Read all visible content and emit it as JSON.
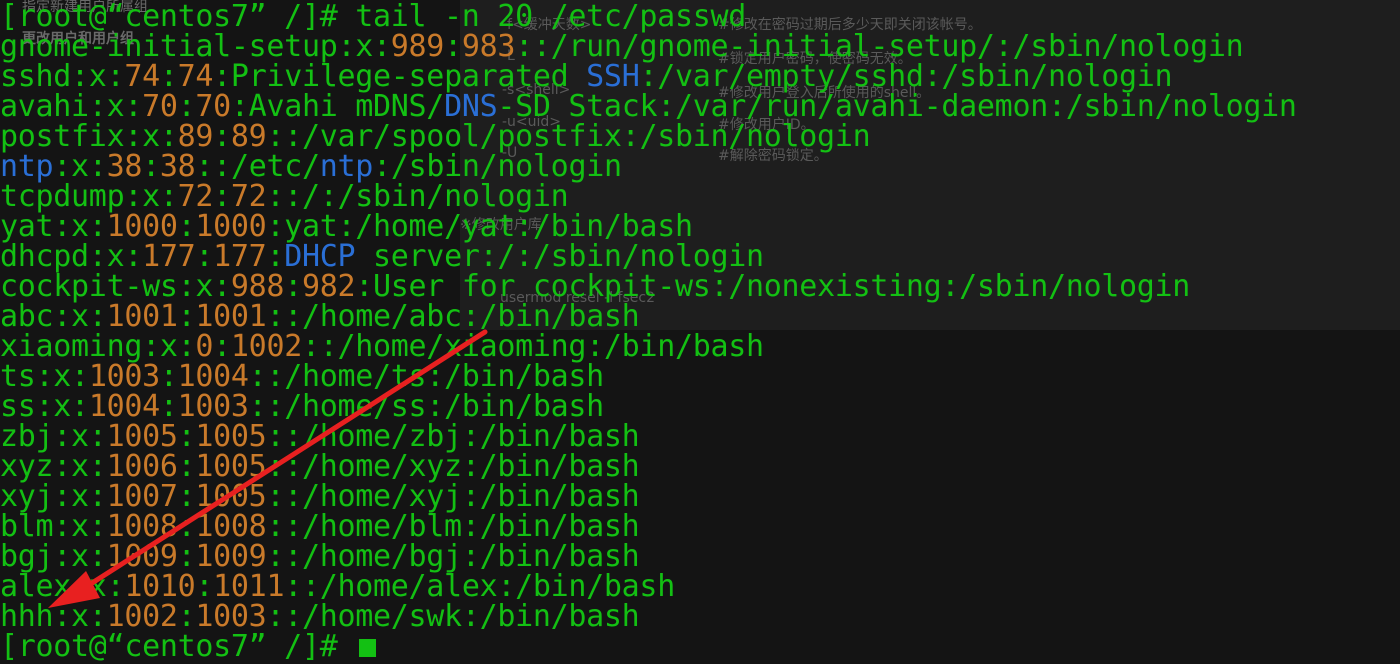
{
  "background_text": {
    "top_left": "指定新建用户所属组",
    "heading": "更改用户和用户组",
    "items": [
      {
        "text": "-f<缓冲天数>"
      },
      {
        "text": "#修改在密码过期后多少天即关闭该帐号。"
      },
      {
        "text": "-L"
      },
      {
        "text": "#锁定用户密码，使密码无效。"
      },
      {
        "text": "-s<shell>"
      },
      {
        "text": "#修改用户登入后所使用的shell。"
      },
      {
        "text": "-u<uid>"
      },
      {
        "text": "#修改用户ID。"
      },
      {
        "text": "-U"
      },
      {
        "text": "#解除密码锁定。"
      },
      {
        "text": "※修改用户库"
      },
      {
        "text": "usermod resel -l fsec2"
      }
    ]
  },
  "terminal": {
    "command_line": "[root@“centos7” /]# tail -n 20 /etc/passwd",
    "prompt_line": "[root@“centos7” /]# ",
    "lines": [
      [
        {
          "t": "gnome-initial-setup:x:",
          "c": "g"
        },
        {
          "t": "989",
          "c": "n"
        },
        {
          "t": ":",
          "c": "g"
        },
        {
          "t": "983",
          "c": "n"
        },
        {
          "t": "::/run/gnome-initial-setup/:/sbin/nologin",
          "c": "g"
        }
      ],
      [
        {
          "t": "sshd:x:",
          "c": "g"
        },
        {
          "t": "74",
          "c": "n"
        },
        {
          "t": ":",
          "c": "g"
        },
        {
          "t": "74",
          "c": "n"
        },
        {
          "t": ":Privilege-separated ",
          "c": "g"
        },
        {
          "t": "SSH",
          "c": "b"
        },
        {
          "t": ":/var/empty/sshd:/sbin/nologin",
          "c": "g"
        }
      ],
      [
        {
          "t": "avahi:x:",
          "c": "g"
        },
        {
          "t": "70",
          "c": "n"
        },
        {
          "t": ":",
          "c": "g"
        },
        {
          "t": "70",
          "c": "n"
        },
        {
          "t": ":Avahi mDNS/",
          "c": "g"
        },
        {
          "t": "DNS",
          "c": "b"
        },
        {
          "t": "-SD Stack:/var/run/avahi-daemon:/sbin/nologin",
          "c": "g"
        }
      ],
      [
        {
          "t": "postfix:x:",
          "c": "g"
        },
        {
          "t": "89",
          "c": "n"
        },
        {
          "t": ":",
          "c": "g"
        },
        {
          "t": "89",
          "c": "n"
        },
        {
          "t": "::/var/spool/postfix:/sbin/nologin",
          "c": "g"
        }
      ],
      [
        {
          "t": "ntp",
          "c": "b"
        },
        {
          "t": ":x:",
          "c": "g"
        },
        {
          "t": "38",
          "c": "n"
        },
        {
          "t": ":",
          "c": "g"
        },
        {
          "t": "38",
          "c": "n"
        },
        {
          "t": "::/etc/",
          "c": "g"
        },
        {
          "t": "ntp",
          "c": "b"
        },
        {
          "t": ":/sbin/nologin",
          "c": "g"
        }
      ],
      [
        {
          "t": "tcpdump:x:",
          "c": "g"
        },
        {
          "t": "72",
          "c": "n"
        },
        {
          "t": ":",
          "c": "g"
        },
        {
          "t": "72",
          "c": "n"
        },
        {
          "t": "::/:/sbin/nologin",
          "c": "g"
        }
      ],
      [
        {
          "t": "yat:x:",
          "c": "g"
        },
        {
          "t": "1000",
          "c": "n"
        },
        {
          "t": ":",
          "c": "g"
        },
        {
          "t": "1000",
          "c": "n"
        },
        {
          "t": ":yat:/home/yat:/bin/bash",
          "c": "g"
        }
      ],
      [
        {
          "t": "dhcpd:x:",
          "c": "g"
        },
        {
          "t": "177",
          "c": "n"
        },
        {
          "t": ":",
          "c": "g"
        },
        {
          "t": "177",
          "c": "n"
        },
        {
          "t": ":",
          "c": "g"
        },
        {
          "t": "DHCP",
          "c": "b"
        },
        {
          "t": " server:/:/sbin/nologin",
          "c": "g"
        }
      ],
      [
        {
          "t": "cockpit-ws:x:",
          "c": "g"
        },
        {
          "t": "988",
          "c": "n"
        },
        {
          "t": ":",
          "c": "g"
        },
        {
          "t": "982",
          "c": "n"
        },
        {
          "t": ":User for cockpit-ws:/nonexisting:/sbin/nologin",
          "c": "g"
        }
      ],
      [
        {
          "t": "abc:x:",
          "c": "g"
        },
        {
          "t": "1001",
          "c": "n"
        },
        {
          "t": ":",
          "c": "g"
        },
        {
          "t": "1001",
          "c": "n"
        },
        {
          "t": "::/home/abc:/bin/bash",
          "c": "g"
        }
      ],
      [
        {
          "t": "xiaoming:x:",
          "c": "g"
        },
        {
          "t": "0",
          "c": "n"
        },
        {
          "t": ":",
          "c": "g"
        },
        {
          "t": "1002",
          "c": "n"
        },
        {
          "t": "::/home/xiaoming:/bin/bash",
          "c": "g"
        }
      ],
      [
        {
          "t": "ts:x:",
          "c": "g"
        },
        {
          "t": "1003",
          "c": "n"
        },
        {
          "t": ":",
          "c": "g"
        },
        {
          "t": "1004",
          "c": "n"
        },
        {
          "t": "::/home/ts:/bin/bash",
          "c": "g"
        }
      ],
      [
        {
          "t": "ss:x:",
          "c": "g"
        },
        {
          "t": "1004",
          "c": "n"
        },
        {
          "t": ":",
          "c": "g"
        },
        {
          "t": "1003",
          "c": "n"
        },
        {
          "t": "::/home/ss:/bin/bash",
          "c": "g"
        }
      ],
      [
        {
          "t": "zbj:x:",
          "c": "g"
        },
        {
          "t": "1005",
          "c": "n"
        },
        {
          "t": ":",
          "c": "g"
        },
        {
          "t": "1005",
          "c": "n"
        },
        {
          "t": "::/home/zbj:/bin/bash",
          "c": "g"
        }
      ],
      [
        {
          "t": "xyz:x:",
          "c": "g"
        },
        {
          "t": "1006",
          "c": "n"
        },
        {
          "t": ":",
          "c": "g"
        },
        {
          "t": "1005",
          "c": "n"
        },
        {
          "t": "::/home/xyz:/bin/bash",
          "c": "g"
        }
      ],
      [
        {
          "t": "xyj:x:",
          "c": "g"
        },
        {
          "t": "1007",
          "c": "n"
        },
        {
          "t": ":",
          "c": "g"
        },
        {
          "t": "1005",
          "c": "n"
        },
        {
          "t": "::/home/xyj:/bin/bash",
          "c": "g"
        }
      ],
      [
        {
          "t": "blm:x:",
          "c": "g"
        },
        {
          "t": "1008",
          "c": "n"
        },
        {
          "t": ":",
          "c": "g"
        },
        {
          "t": "1008",
          "c": "n"
        },
        {
          "t": "::/home/blm:/bin/bash",
          "c": "g"
        }
      ],
      [
        {
          "t": "bgj:x:",
          "c": "g"
        },
        {
          "t": "1009",
          "c": "n"
        },
        {
          "t": ":",
          "c": "g"
        },
        {
          "t": "1009",
          "c": "n"
        },
        {
          "t": "::/home/bgj:/bin/bash",
          "c": "g"
        }
      ],
      [
        {
          "t": "alex:x:",
          "c": "g"
        },
        {
          "t": "1010",
          "c": "n"
        },
        {
          "t": ":",
          "c": "g"
        },
        {
          "t": "1011",
          "c": "n"
        },
        {
          "t": "::/home/alex:/bin/bash",
          "c": "g"
        }
      ],
      [
        {
          "t": "hhh:x:",
          "c": "g"
        },
        {
          "t": "1002",
          "c": "n"
        },
        {
          "t": ":",
          "c": "g"
        },
        {
          "t": "1003",
          "c": "n"
        },
        {
          "t": "::/home/swk:/bin/bash",
          "c": "g"
        }
      ]
    ]
  },
  "colors": {
    "background": "#141414",
    "text_green": "#13c013",
    "number_orange": "#c97a2a",
    "keyword_blue": "#2a6fd6",
    "arrow_red": "#e82020"
  }
}
